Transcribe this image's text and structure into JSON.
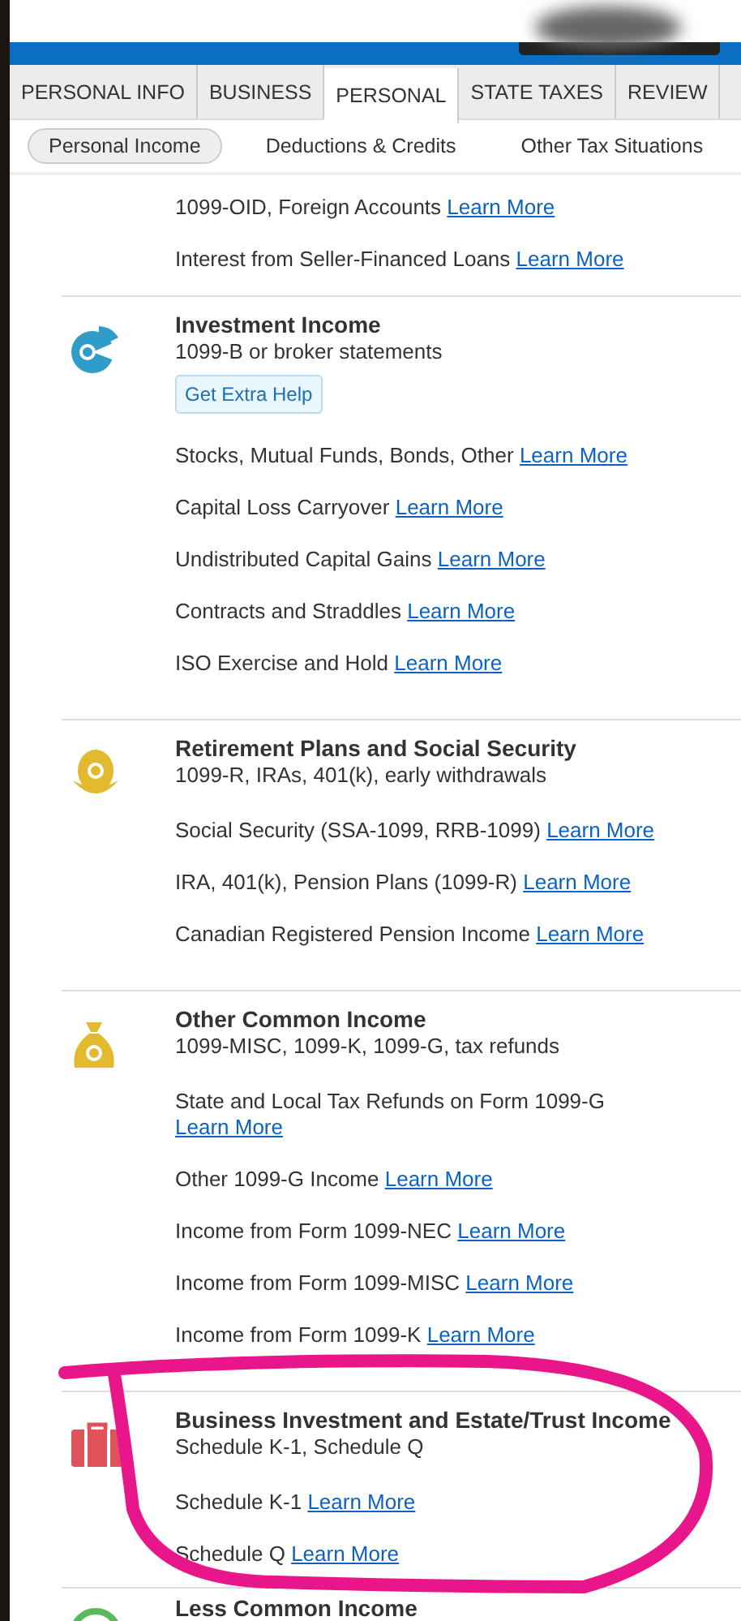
{
  "tabs": [
    {
      "label": "PERSONAL INFO",
      "selected": false
    },
    {
      "label": "BUSINESS",
      "selected": false
    },
    {
      "label": "PERSONAL",
      "selected": true
    },
    {
      "label": "STATE TAXES",
      "selected": false
    },
    {
      "label": "REVIEW",
      "selected": false
    }
  ],
  "subtabs": [
    {
      "label": "Personal Income",
      "selected": true
    },
    {
      "label": "Deductions & Credits",
      "selected": false
    },
    {
      "label": "Other Tax Situations",
      "selected": false
    }
  ],
  "top_items": [
    {
      "text": "1099-OID, Foreign Accounts",
      "link": "Learn More"
    },
    {
      "text": "Interest from Seller-Financed Loans",
      "link": "Learn More"
    }
  ],
  "sections": [
    {
      "kind": "investment",
      "title": "Investment Income",
      "subtitle": "1099-B or broker statements",
      "help_button": "Get Extra Help",
      "items": [
        {
          "text": "Stocks, Mutual Funds, Bonds, Other",
          "link": "Learn More"
        },
        {
          "text": "Capital Loss Carryover",
          "link": "Learn More"
        },
        {
          "text": "Undistributed Capital Gains",
          "link": "Learn More"
        },
        {
          "text": "Contracts and Straddles",
          "link": "Learn More"
        },
        {
          "text": "ISO Exercise and Hold",
          "link": "Learn More"
        }
      ]
    },
    {
      "kind": "retirement",
      "title": "Retirement Plans and Social Security",
      "subtitle": "1099-R, IRAs, 401(k), early withdrawals",
      "items": [
        {
          "text": "Social Security (SSA-1099, RRB-1099)",
          "link": "Learn More"
        },
        {
          "text": "IRA, 401(k), Pension Plans (1099-R)",
          "link": "Learn More"
        },
        {
          "text": "Canadian Registered Pension Income",
          "link": "Learn More"
        }
      ]
    },
    {
      "kind": "common",
      "title": "Other Common Income",
      "subtitle": "1099-MISC, 1099-K, 1099-G, tax refunds",
      "items": [
        {
          "text": "State and Local Tax Refunds on Form 1099-G",
          "link": "Learn More"
        },
        {
          "text": "Other 1099-G Income",
          "link": "Learn More"
        },
        {
          "text": "Income from Form 1099-NEC",
          "link": "Learn More"
        },
        {
          "text": "Income from Form 1099-MISC",
          "link": "Learn More"
        },
        {
          "text": "Income from Form 1099-K",
          "link": "Learn More"
        }
      ]
    },
    {
      "kind": "business",
      "title": "Business Investment and Estate/Trust Income",
      "subtitle": "Schedule K-1, Schedule Q",
      "items": [
        {
          "text": "Schedule K-1",
          "link": "Learn More"
        },
        {
          "text": "Schedule Q",
          "link": "Learn More"
        }
      ]
    },
    {
      "kind": "less-common",
      "title": "Less Common Income"
    }
  ]
}
